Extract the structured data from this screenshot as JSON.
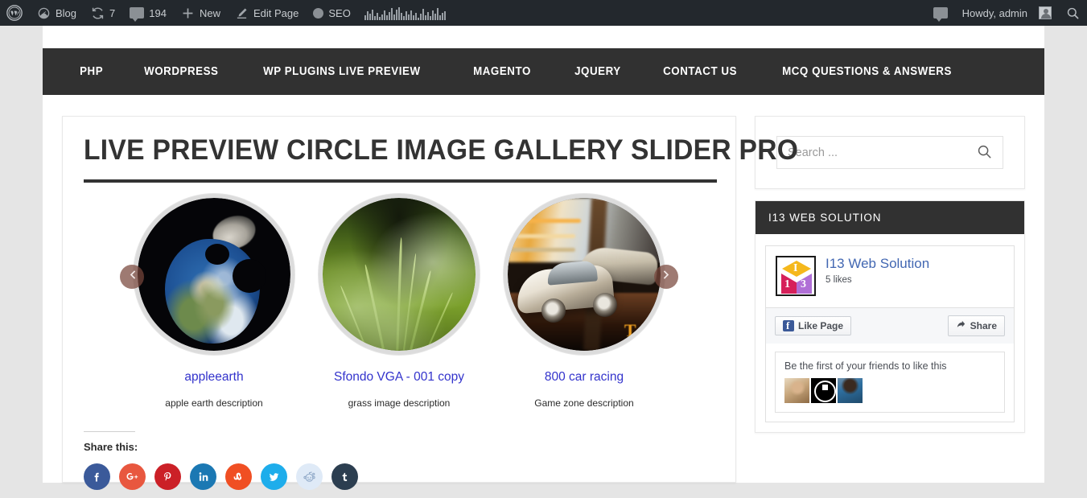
{
  "adminbar": {
    "logo_icon": "wordpress-logo-icon",
    "items": [
      {
        "icon": "dashboard-icon",
        "label": "Blog"
      },
      {
        "icon": "update-icon",
        "label": "7"
      },
      {
        "icon": "comment-bubble-icon",
        "label": "194"
      },
      {
        "icon": "plus-icon",
        "label": "New"
      },
      {
        "icon": "pencil-icon",
        "label": "Edit Page"
      },
      {
        "icon": "seo-dot-icon",
        "label": "SEO"
      }
    ],
    "seo_graph_icon": "seo-bar-graph-icon",
    "notification_icon": "comment-moderation-icon",
    "howdy": "Howdy, admin",
    "avatar_icon": "user-avatar-icon",
    "search_icon": "search-icon"
  },
  "nav": {
    "items": [
      {
        "label": "PHP"
      },
      {
        "label": "WORDPRESS"
      },
      {
        "label": "WP PLUGINS LIVE PREVIEW"
      },
      {
        "label": "MAGENTO"
      },
      {
        "label": "JQUERY"
      },
      {
        "label": "CONTACT US"
      },
      {
        "label": "MCQ QUESTIONS & ANSWERS"
      }
    ]
  },
  "article": {
    "title": "LIVE PREVIEW CIRCLE IMAGE GALLERY SLIDER PRO",
    "slides": [
      {
        "title": "appleearth",
        "description": "apple earth description",
        "image": "apple-earth-photo"
      },
      {
        "title": "Sfondo VGA - 001 copy",
        "description": "grass image description",
        "image": "grass-photo"
      },
      {
        "title": "800 car racing",
        "description": "Game zone description",
        "image": "car-racing-photo"
      }
    ],
    "prev_arrow_icon": "chevron-left-icon",
    "next_arrow_icon": "chevron-right-icon",
    "share": {
      "label": "Share this:",
      "icons": [
        {
          "name": "facebook-share-icon",
          "glyph": "f",
          "color": "#3b5a9a"
        },
        {
          "name": "googleplus-share-icon",
          "glyph": "g+",
          "color": "#e8573f"
        },
        {
          "name": "pinterest-share-icon",
          "glyph": "p",
          "color": "#cb2027"
        },
        {
          "name": "linkedin-share-icon",
          "glyph": "in",
          "color": "#1b78b3"
        },
        {
          "name": "stumbleupon-share-icon",
          "glyph": "su",
          "color": "#f04f23"
        },
        {
          "name": "twitter-share-icon",
          "glyph": "t",
          "color": "#1eadeb"
        },
        {
          "name": "reddit-share-icon",
          "glyph": "r",
          "color": "#dfeaf7"
        },
        {
          "name": "tumblr-share-icon",
          "glyph": "t",
          "color": "#2c3e50"
        }
      ]
    }
  },
  "sidebar": {
    "search": {
      "placeholder": "Search ...",
      "value": "",
      "icon": "search-icon"
    },
    "facebook_widget": {
      "heading": "I13 WEB SOLUTION",
      "page_name": "I13 Web Solution",
      "likes": "5 likes",
      "logo_icon": "i13-cube-logo-icon",
      "like_button": "Like Page",
      "share_button": "Share",
      "friends_text": "Be the first of your friends to like this",
      "thumb_count": 3
    }
  },
  "colors": {
    "adminbar_bg": "#23282d",
    "nav_bg": "#313131",
    "page_bg": "#e5e5e5",
    "link": "#3333cc",
    "facebook_blue": "#4267b2",
    "title": "#333333"
  }
}
